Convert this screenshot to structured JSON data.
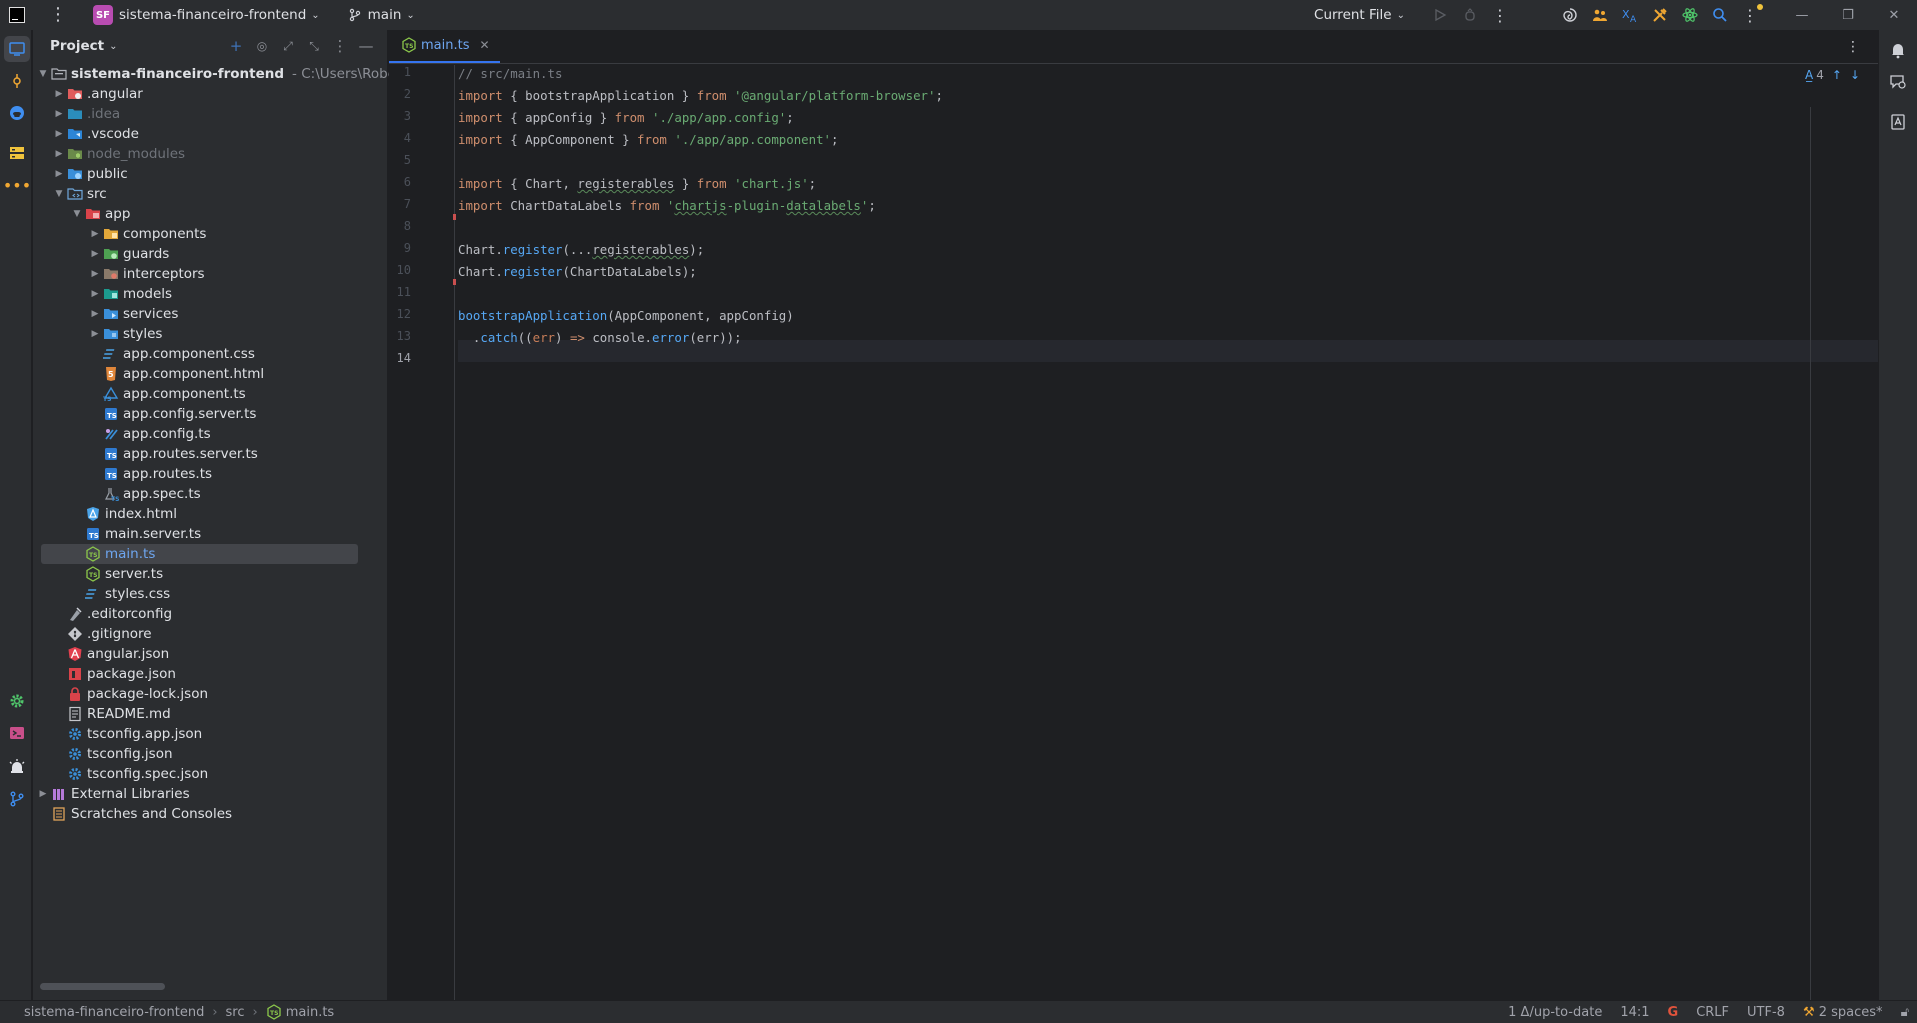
{
  "titlebar": {
    "project_badge": "SF",
    "project_name": "sistema-financeiro-frontend",
    "branch": "main",
    "run_config": "Current File"
  },
  "sidebar": {
    "panel_title": "Project"
  },
  "tree": {
    "root": "sistema-financeiro-frontend",
    "root_path": "C:\\Users\\Roberth",
    "angular": ".angular",
    "idea": ".idea",
    "vscode": ".vscode",
    "node_modules": "node_modules",
    "public": "public",
    "src": "src",
    "app": "app",
    "components": "components",
    "guards": "guards",
    "interceptors": "interceptors",
    "models": "models",
    "services": "services",
    "styles_folder": "styles",
    "app_component_css": "app.component.css",
    "app_component_html": "app.component.html",
    "app_component_ts": "app.component.ts",
    "app_config_server_ts": "app.config.server.ts",
    "app_config_ts": "app.config.ts",
    "app_routes_server_ts": "app.routes.server.ts",
    "app_routes_ts": "app.routes.ts",
    "app_spec_ts": "app.spec.ts",
    "index_html": "index.html",
    "main_server_ts": "main.server.ts",
    "main_ts": "main.ts",
    "server_ts": "server.ts",
    "styles_css": "styles.css",
    "editorconfig": ".editorconfig",
    "gitignore": ".gitignore",
    "angular_json": "angular.json",
    "package_json": "package.json",
    "package_lock_json": "package-lock.json",
    "readme": "README.md",
    "tsconfig_app": "tsconfig.app.json",
    "tsconfig": "tsconfig.json",
    "tsconfig_spec": "tsconfig.spec.json",
    "external_libraries": "External Libraries",
    "scratches": "Scratches and Consoles"
  },
  "editor": {
    "tab_label": "main.ts",
    "inspection_count": "4",
    "line_numbers": [
      "1",
      "2",
      "3",
      "4",
      "5",
      "6",
      "7",
      "8",
      "9",
      "10",
      "11",
      "12",
      "13",
      "14"
    ],
    "code": {
      "l1": "// src/main.ts",
      "import": "import",
      "from": "from",
      "l2_mid": " { bootstrapApplication } ",
      "l2_str": "'@angular/platform-browser'",
      "l3_mid": " { appConfig } ",
      "l3_str": "'./app/app.config'",
      "l4_mid": " { AppComponent } ",
      "l4_str": "'./app/app.component'",
      "l6_a": " { Chart, ",
      "registerables": "registerables",
      "l6_b": " } ",
      "l6_str": "'chart.js'",
      "l7_mid": " ChartDataLabels ",
      "l7_str_a": "'",
      "l7_str_b": "chartjs",
      "l7_str_c": "-plugin-",
      "l7_str_d": "datalabels",
      "l7_str_e": "'",
      "chart": "Chart",
      "register": "register",
      "l9_args_a": "(...",
      "l9_args_b": ");",
      "l10_args": "(ChartDataLabels);",
      "bootstrap": "bootstrapApplication",
      "l12_args": "(AppComponent, appConfig)",
      "catch": "catch",
      "err": "err",
      "arrow": "=>",
      "console": "console",
      "error": "error",
      "semi": ";",
      "dot": "."
    }
  },
  "statusbar": {
    "crumb_project": "sistema-financeiro-frontend",
    "crumb_src": "src",
    "crumb_file": "main.ts",
    "vcs_status": "1 Δ/up-to-date",
    "position": "14:1",
    "line_endings": "CRLF",
    "encoding": "UTF-8",
    "indent": "2 spaces*"
  },
  "colors": {
    "accent": "#3574f0",
    "background": "#1e1f22",
    "panel": "#2b2d30",
    "project_badge": "#b84cb1"
  }
}
